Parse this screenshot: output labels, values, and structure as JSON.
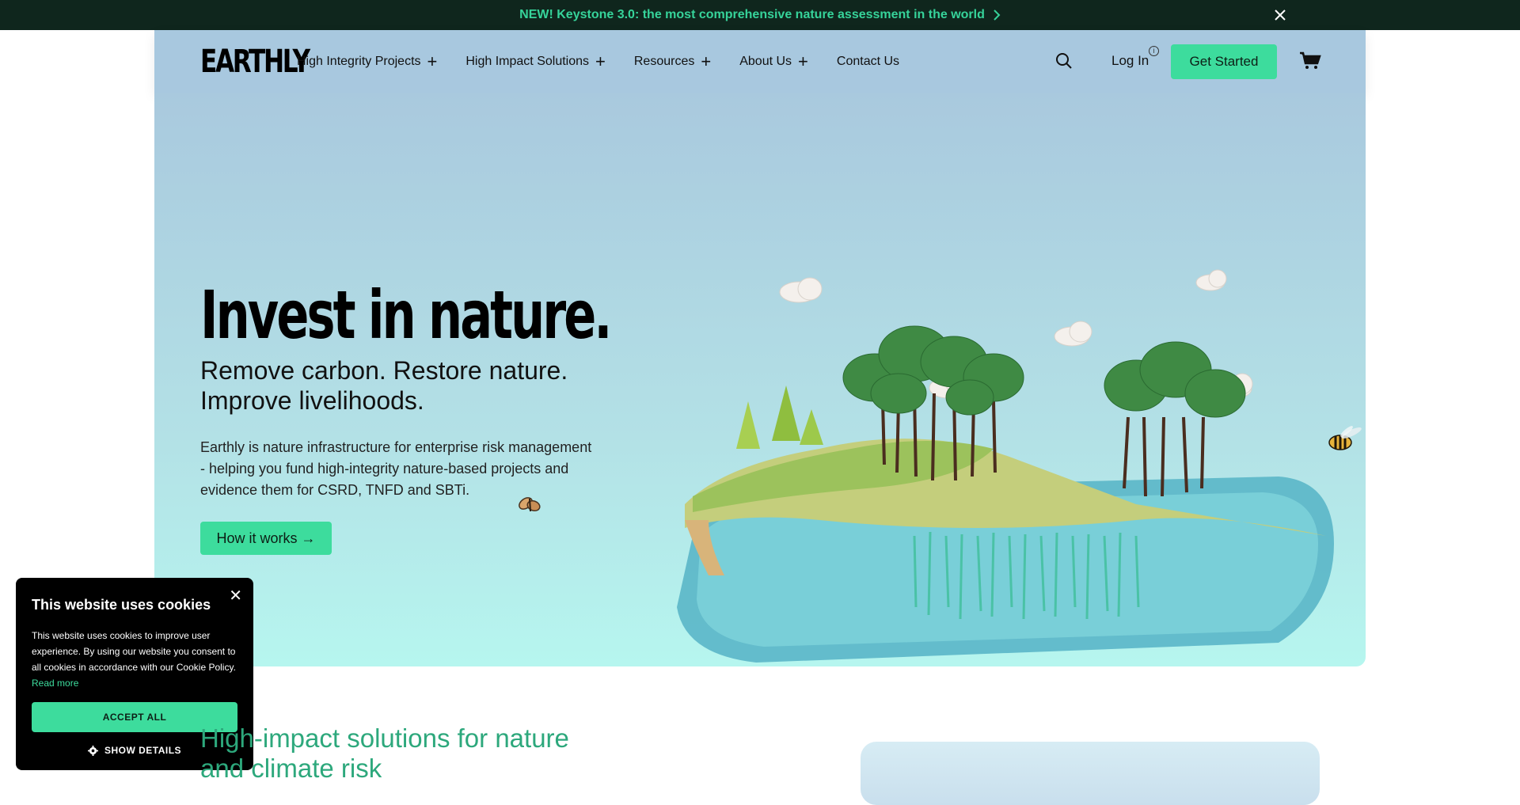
{
  "announcement": {
    "text": "NEW! Keystone 3.0: the most comprehensive nature assessment in the world",
    "chevron_icon": "chevron-right-icon",
    "close_icon": "close-icon"
  },
  "header": {
    "logo": "EARTHLY",
    "nav": [
      {
        "label": "High Integrity Projects",
        "expandable": true
      },
      {
        "label": "High Impact Solutions",
        "expandable": true
      },
      {
        "label": "Resources",
        "expandable": true
      },
      {
        "label": "About Us",
        "expandable": true
      },
      {
        "label": "Contact Us",
        "expandable": false
      }
    ],
    "login_label": "Log In",
    "info_glyph": "i",
    "cta_label": "Get Started",
    "icons": {
      "search": "search-icon",
      "cart": "cart-icon",
      "expand": "plus-icon"
    }
  },
  "hero": {
    "title": "Invest in nature.",
    "subtitle": "Remove carbon. Restore nature. Improve livelihoods.",
    "description": "Earthly is nature infrastructure for enterprise risk management - helping you fund high-integrity nature-based projects and evidence them for CSRD, TNFD and SBTi.",
    "cta_label": "How it works →"
  },
  "cookie_banner": {
    "title": "This website uses cookies",
    "body": "This website uses cookies to improve user experience. By using our website you consent to all cookies in accordance with our Cookie Policy.",
    "read_more": "Read more",
    "accept_label": "ACCEPT ALL",
    "details_label": "SHOW DETAILS",
    "close_glyph": "✕"
  },
  "section": {
    "title": "High-impact solutions for nature and climate risk"
  },
  "colors": {
    "accent": "#3ddc9d",
    "announcement_bg": "#0f261d",
    "announcement_text": "#36d39a",
    "section_title": "#2da87c"
  }
}
